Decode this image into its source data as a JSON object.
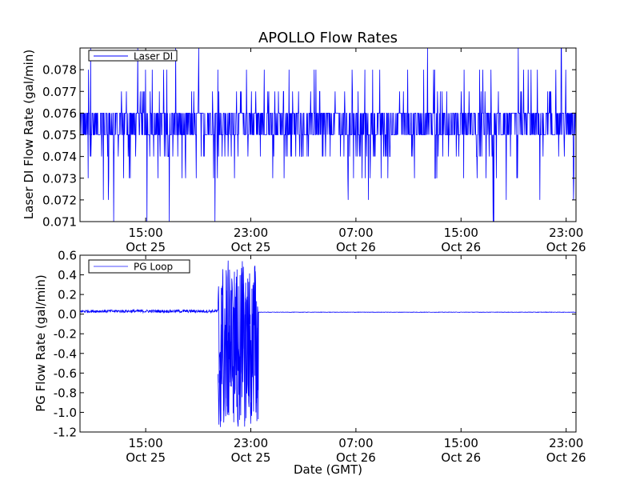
{
  "figure": {
    "title": "APOLLO Flow Rates",
    "xlabel": "Date (GMT)"
  },
  "chart_data": [
    {
      "type": "line",
      "title": "APOLLO Flow Rates",
      "ylabel": "Laser DI Flow Rate (gal/min)",
      "xlabel": "",
      "legend": {
        "label": "Laser DI",
        "placement": "top-left"
      },
      "x_range": [
        "2012-10-25 10:00",
        "2012-10-26 23:45"
      ],
      "ylim": [
        0.071,
        0.079
      ],
      "yticks": [
        0.071,
        0.072,
        0.073,
        0.074,
        0.075,
        0.076,
        0.077,
        0.078
      ],
      "ytick_labels": [
        "0.071",
        "0.072",
        "0.073",
        "0.074",
        "0.075",
        "0.076",
        "0.077",
        "0.078"
      ],
      "xticks": [
        "2012-10-25 15:00",
        "2012-10-25 23:00",
        "2012-10-26 07:00",
        "2012-10-26 15:00",
        "2012-10-26 23:00"
      ],
      "xtick_labels": [
        {
          "time": "15:00",
          "date": "Oct 25"
        },
        {
          "time": "23:00",
          "date": "Oct 25"
        },
        {
          "time": "07:00",
          "date": "Oct 26"
        },
        {
          "time": "15:00",
          "date": "Oct 26"
        },
        {
          "time": "23:00",
          "date": "Oct 26"
        }
      ],
      "series": [
        {
          "name": "Laser DI",
          "color": "#0000ff",
          "baseline_levels": [
            0.075,
            0.076
          ],
          "spike_levels": [
            0.071,
            0.072,
            0.073,
            0.074,
            0.077,
            0.078,
            0.079
          ],
          "x": [
            "2012-10-25 10:00",
            "2012-10-25 12:00",
            "2012-10-25 16:00",
            "2012-10-25 20:00",
            "2012-10-26 00:00",
            "2012-10-26 04:00",
            "2012-10-26 08:00",
            "2012-10-26 12:00",
            "2012-10-26 16:00",
            "2012-10-26 20:00",
            "2012-10-26 23:45"
          ],
          "y": [
            0.0755,
            0.0755,
            0.0755,
            0.0755,
            0.0755,
            0.0755,
            0.0755,
            0.0755,
            0.0755,
            0.0755,
            0.0755
          ]
        }
      ]
    },
    {
      "type": "line",
      "title": "",
      "ylabel": "PG Flow Rate (gal/min)",
      "xlabel": "Date (GMT)",
      "legend": {
        "label": "PG Loop",
        "placement": "top-left"
      },
      "x_range": [
        "2012-10-25 10:00",
        "2012-10-26 23:45"
      ],
      "ylim": [
        -1.2,
        0.6
      ],
      "yticks": [
        -1.2,
        -1.0,
        -0.8,
        -0.6,
        -0.4,
        -0.2,
        0.0,
        0.2,
        0.4,
        0.6
      ],
      "ytick_labels": [
        "-1.2",
        "-1.0",
        "-0.8",
        "-0.6",
        "-0.4",
        "-0.2",
        "0.0",
        "0.2",
        "0.4",
        "0.6"
      ],
      "xticks": [
        "2012-10-25 15:00",
        "2012-10-25 23:00",
        "2012-10-26 07:00",
        "2012-10-26 15:00",
        "2012-10-26 23:00"
      ],
      "xtick_labels": [
        {
          "time": "15:00",
          "date": "Oct 25"
        },
        {
          "time": "23:00",
          "date": "Oct 25"
        },
        {
          "time": "07:00",
          "date": "Oct 26"
        },
        {
          "time": "15:00",
          "date": "Oct 26"
        },
        {
          "time": "23:00",
          "date": "Oct 26"
        }
      ],
      "series": [
        {
          "name": "PG Loop",
          "color": "#0000ff",
          "x": [
            "2012-10-25 10:00",
            "2012-10-25 14:00",
            "2012-10-25 18:00",
            "2012-10-25 20:30",
            "2012-10-25 20:35",
            "2012-10-25 21:30",
            "2012-10-25 22:30",
            "2012-10-25 23:30",
            "2012-10-25 23:35",
            "2012-10-26 04:00",
            "2012-10-26 12:00",
            "2012-10-26 20:00",
            "2012-10-26 23:45"
          ],
          "y": [
            0.03,
            0.03,
            0.03,
            0.03,
            -0.2,
            -0.3,
            -0.35,
            -0.3,
            0.02,
            0.02,
            0.02,
            0.02,
            0.02
          ],
          "noisy_range": {
            "start": "2012-10-25 20:30",
            "end": "2012-10-25 23:35",
            "min": -1.15,
            "max": 0.55
          },
          "baseline_before": 0.03,
          "baseline_after": 0.02
        }
      ]
    }
  ]
}
